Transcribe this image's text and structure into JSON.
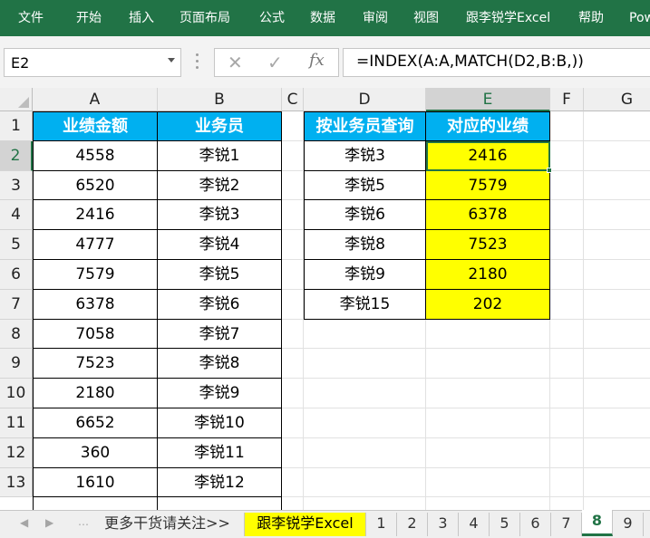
{
  "ribbon": {
    "tabs": [
      "文件",
      "开始",
      "插入",
      "页面布局",
      "公式",
      "数据",
      "审阅",
      "视图",
      "跟李锐学Excel",
      "帮助",
      "Pow"
    ]
  },
  "formula_bar": {
    "name_box": "E2",
    "cancel_icon": "✕",
    "confirm_icon": "✓",
    "fx_label": "fx",
    "formula": "=INDEX(A:A,MATCH(D2,B:B,))"
  },
  "columns": [
    "A",
    "B",
    "C",
    "D",
    "E",
    "F",
    "G"
  ],
  "rows": [
    "1",
    "2",
    "3",
    "4",
    "5",
    "6",
    "7",
    "8",
    "9",
    "10",
    "11",
    "12",
    "13"
  ],
  "table1": {
    "headers": [
      "业绩金额",
      "业务员"
    ],
    "rows": [
      [
        "4558",
        "李锐1"
      ],
      [
        "6520",
        "李锐2"
      ],
      [
        "2416",
        "李锐3"
      ],
      [
        "4777",
        "李锐4"
      ],
      [
        "7579",
        "李锐5"
      ],
      [
        "6378",
        "李锐6"
      ],
      [
        "7058",
        "李锐7"
      ],
      [
        "7523",
        "李锐8"
      ],
      [
        "2180",
        "李锐9"
      ],
      [
        "6652",
        "李锐10"
      ],
      [
        "360",
        "李锐11"
      ],
      [
        "1610",
        "李锐12"
      ]
    ]
  },
  "table2": {
    "headers": [
      "按业务员查询",
      "对应的业绩"
    ],
    "rows": [
      [
        "李锐3",
        "2416"
      ],
      [
        "李锐5",
        "7579"
      ],
      [
        "李锐6",
        "6378"
      ],
      [
        "李锐8",
        "7523"
      ],
      [
        "李锐9",
        "2180"
      ],
      [
        "李锐15",
        "202"
      ]
    ]
  },
  "colors": {
    "ribbon": "#217346",
    "header_fill": "#00b0f0",
    "result_fill": "#ffff00"
  },
  "sheet_tabs": {
    "items": [
      "更多干货请关注>>",
      "跟李锐学Excel",
      "1",
      "2",
      "3",
      "4",
      "5",
      "6",
      "7",
      "8",
      "9"
    ],
    "active": "8"
  }
}
